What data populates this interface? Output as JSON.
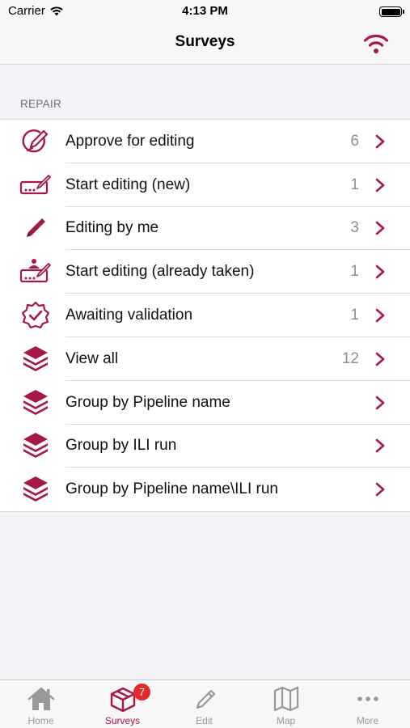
{
  "status_bar": {
    "carrier": "Carrier",
    "time": "4:13 PM"
  },
  "nav": {
    "title": "Surveys",
    "action_icon": "wifi-icon"
  },
  "accent_color": "#a8174a",
  "section": {
    "header": "REPAIR"
  },
  "rows": [
    {
      "label": "Approve for editing",
      "count": "6",
      "icon": "approve-edit-icon"
    },
    {
      "label": "Start editing (new)",
      "count": "1",
      "icon": "start-editing-icon"
    },
    {
      "label": "Editing by me",
      "count": "3",
      "icon": "pencil-icon"
    },
    {
      "label": "Start editing (already taken)",
      "count": "1",
      "icon": "start-editing-taken-icon"
    },
    {
      "label": "Awaiting validation",
      "count": "1",
      "icon": "verified-badge-icon"
    },
    {
      "label": "View all",
      "count": "12",
      "icon": "layers-icon"
    },
    {
      "label": "Group by Pipeline name",
      "count": "",
      "icon": "layers-icon"
    },
    {
      "label": "Group by ILI run",
      "count": "",
      "icon": "layers-icon"
    },
    {
      "label": "Group by Pipeline name\\ILI run",
      "count": "",
      "icon": "layers-icon"
    }
  ],
  "tabs": [
    {
      "label": "Home",
      "icon": "home-icon"
    },
    {
      "label": "Surveys",
      "icon": "surveys-box-icon",
      "badge": "7",
      "active": true
    },
    {
      "label": "Edit",
      "icon": "pencil-icon"
    },
    {
      "label": "Map",
      "icon": "map-icon"
    },
    {
      "label": "More",
      "icon": "more-dots-icon"
    }
  ]
}
